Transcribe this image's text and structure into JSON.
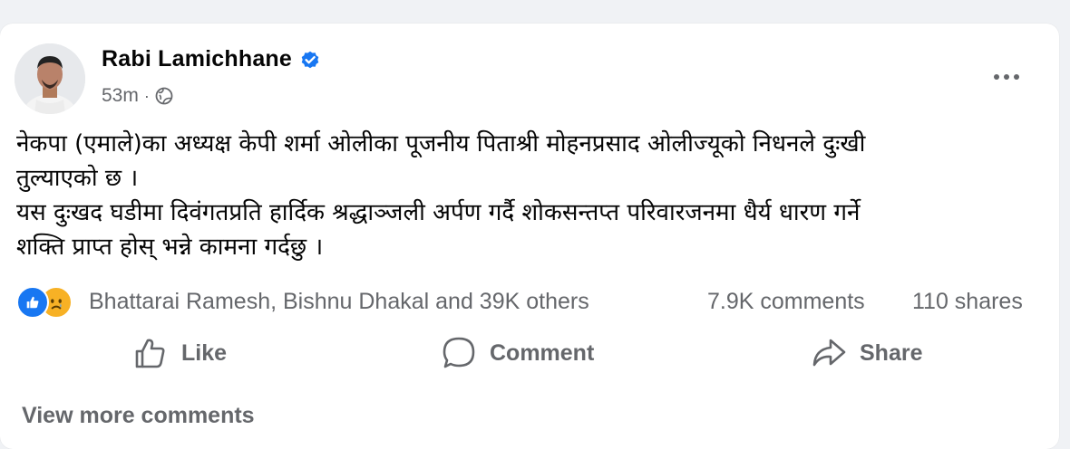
{
  "post": {
    "author": "Rabi Lamichhane",
    "timestamp": "53m",
    "separator": "·",
    "text_lines": [
      "नेकपा (एमाले)का अध्यक्ष केपी शर्मा ओलीका पूजनीय पिताश्री मोहनप्रसाद ओलीज्यूको निधनले दुःखी",
      "तुल्याएको छ ।",
      "यस दुःखद घडीमा दिवंगतप्रति हार्दिक श्रद्धाञ्जली अर्पण गर्दै शोकसन्तप्त परिवारजनमा धैर्य धारण गर्ने",
      "शक्ति प्राप्त होस् भन्ने कामना गर्दछु ।"
    ]
  },
  "stats": {
    "reactors": "Bhattarai Ramesh, Bishnu Dhakal and 39K others",
    "comments": "7.9K comments",
    "shares": "110 shares"
  },
  "actions": {
    "like": "Like",
    "comment": "Comment",
    "share": "Share"
  },
  "view_more": "View more comments",
  "colors": {
    "background": "#f0f2f5",
    "card": "#ffffff",
    "text_primary": "#050505",
    "text_secondary": "#65676b",
    "brand_blue": "#1877f2",
    "sad_yellow": "#f7b125"
  },
  "icons": [
    "avatar",
    "verified-badge-icon",
    "globe-icon",
    "more-options-icon",
    "like-reaction-icon",
    "sad-reaction-icon",
    "like-icon",
    "comment-icon",
    "share-icon"
  ]
}
